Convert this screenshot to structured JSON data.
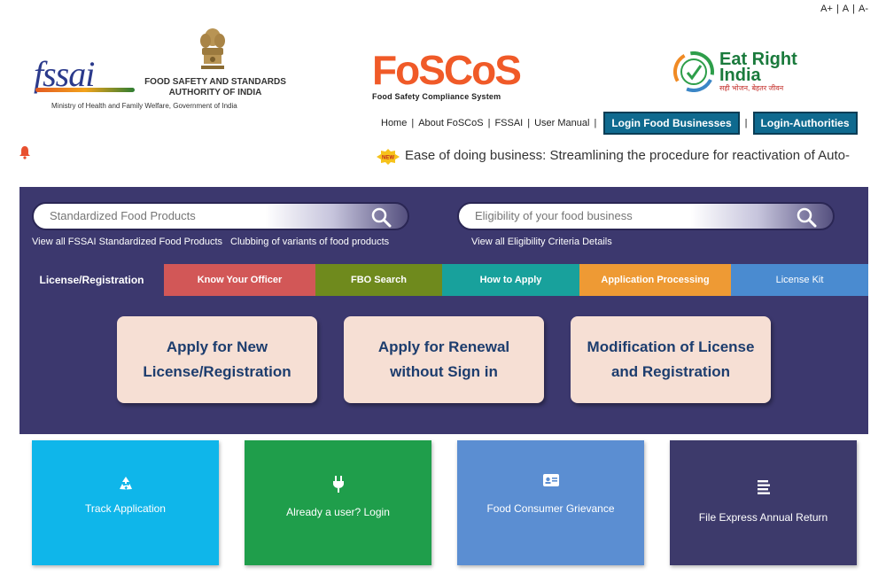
{
  "font_controls": [
    "A+",
    "A",
    "A-"
  ],
  "header": {
    "fssai_logo_text": "fssai",
    "fssai_ministry": "Ministry of Health and Family Welfare, Government of India",
    "fssai_name_line1": "FOOD SAFETY AND STANDARDS",
    "fssai_name_line2": "AUTHORITY OF INDIA",
    "foscos_title": "FoSCoS",
    "foscos_subtitle": "Food Safety Compliance System",
    "eri_line1": "Eat Right",
    "eri_line2": "India",
    "eri_tagline": "सही भोजन, बेहतर जीवन"
  },
  "nav": {
    "links": [
      "Home",
      "About FoSCoS",
      "FSSAI",
      "User Manual"
    ],
    "login_food_businesses": "Login Food Businesses",
    "login_authorities": "Login-Authorities"
  },
  "ticker": {
    "badge": "NEW",
    "text": "Ease of doing business: Streamlining the procedure for reactivation of Auto-"
  },
  "search": {
    "products_placeholder": "Standardized Food Products",
    "eligibility_placeholder": "Eligibility of your food business",
    "link_standardized": "View all FSSAI Standardized Food Products",
    "link_clubbing": "Clubbing of variants of food products",
    "link_eligibility": "View all Eligibility Criteria Details"
  },
  "tabs": [
    {
      "label": "License/Registration",
      "color": "#3c386e"
    },
    {
      "label": "Know Your Officer",
      "color": "#d25757"
    },
    {
      "label": "FBO Search",
      "color": "#6f8a1d"
    },
    {
      "label": "How to Apply",
      "color": "#18a19c"
    },
    {
      "label": "Application Processing",
      "color": "#ee9a34"
    },
    {
      "label": "License Kit",
      "color": "#4a8bd0"
    }
  ],
  "actions": {
    "new_line1": "Apply for New",
    "new_line2": "License/Registration",
    "renewal_line1": "Apply for Renewal",
    "renewal_line2": "without Sign in",
    "modify_line1": "Modification of License",
    "modify_line2": "and Registration"
  },
  "tiles": [
    {
      "label": "Track Application",
      "color": "#0fb6ea",
      "icon": "recycle-icon"
    },
    {
      "label": "Already a user? Login",
      "color": "#1f9e4b",
      "icon": "plug-icon"
    },
    {
      "label": "Food Consumer Grievance",
      "color": "#5b8ed2",
      "icon": "id-card-icon"
    },
    {
      "label": "File Express Annual Return",
      "color": "#3d3a6b",
      "icon": "document-lines-icon"
    }
  ]
}
